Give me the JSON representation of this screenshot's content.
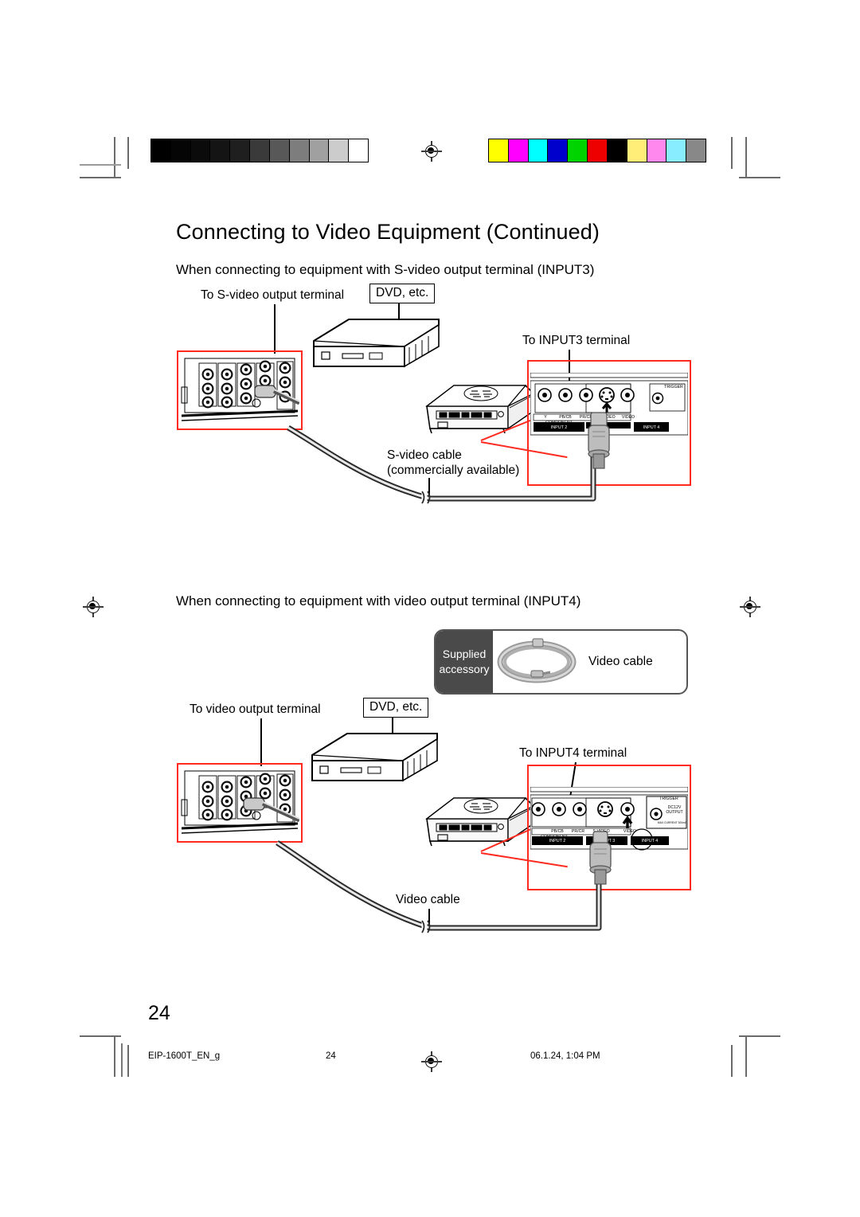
{
  "page": {
    "title": "Connecting to Video Equipment (Continued)",
    "number": "24"
  },
  "footer": {
    "filename": "EIP-1600T_EN_g",
    "page": "24",
    "timestamp": "06.1.24, 1:04 PM"
  },
  "calibration": {
    "gray_swatches": [
      "#000000",
      "#050505",
      "#0b0b0b",
      "#141414",
      "#1f1f1f",
      "#3a3a3a",
      "#585858",
      "#7d7d7d",
      "#a0a0a0",
      "#cccccc",
      "#ffffff"
    ],
    "color_swatches": [
      "#ffff00",
      "#ff00ff",
      "#00ffff",
      "#0000cc",
      "#00d400",
      "#ee0000",
      "#000000",
      "#ffee77",
      "#ff88ee",
      "#88eeff",
      "#888888"
    ]
  },
  "sections": [
    {
      "heading": "When connecting to equipment with S-video output terminal (INPUT3)",
      "source_label": "To S-video output terminal",
      "device_label": "DVD, etc.",
      "target_label": "To INPUT3 terminal",
      "cable_label_line1": "S-video cable",
      "cable_label_line2": "(commercially available)"
    },
    {
      "heading": "When connecting to equipment with video output terminal (INPUT4)",
      "source_label": "To video output terminal",
      "device_label": "DVD, etc.",
      "target_label": "To INPUT4 terminal",
      "cable_label_line1": "Video cable",
      "cable_label_line2": ""
    }
  ],
  "accessory_box": {
    "badge_line1": "Supplied",
    "badge_line2": "accessory",
    "item_label": "Video cable"
  },
  "terminal_panel": {
    "jack_labels": [
      "Y",
      "PB/CB",
      "PR/CR",
      "S-VIDEO",
      "VIDEO"
    ],
    "group_component": "COMPONENT",
    "input2": "INPUT 2",
    "input3": "INPUT 3",
    "input4": "INPUT 4",
    "trigger_title": "TRIGGER",
    "trigger_line1": "DC12V",
    "trigger_line2": "OUTPUT",
    "trigger_note": "MAX CURRENT 300mA"
  },
  "colors": {
    "callout_red": "#ff2a20",
    "accessory_badge": "#4a4a4a"
  }
}
